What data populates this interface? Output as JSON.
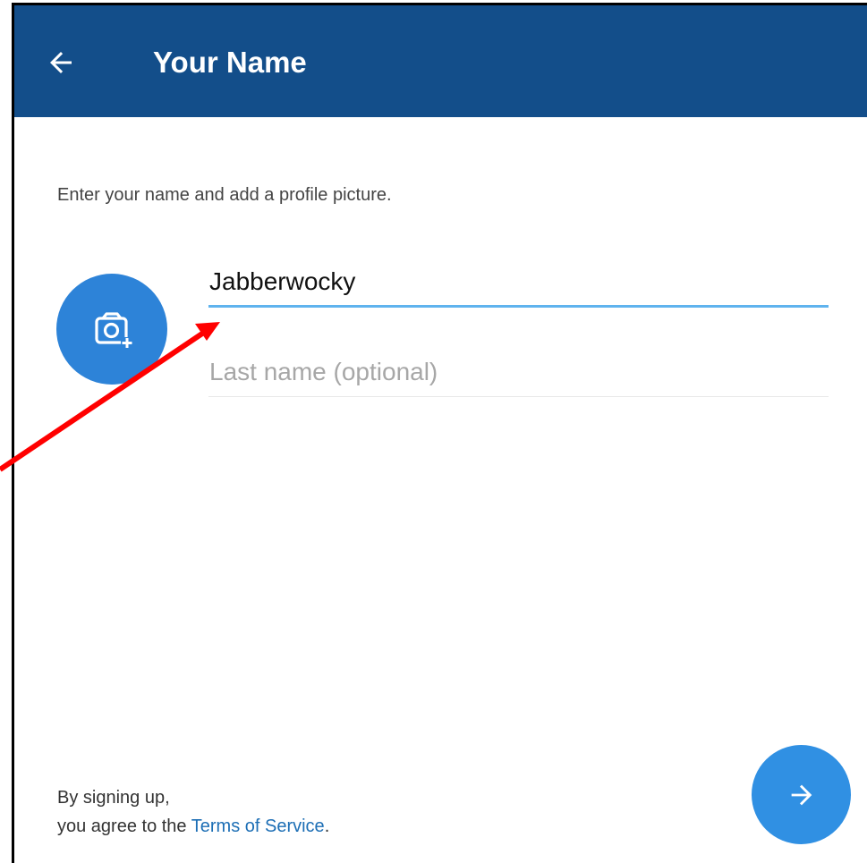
{
  "header": {
    "back_icon": "arrow-left-icon",
    "title": "Your Name",
    "background_color": "#134e8a"
  },
  "form": {
    "instructions": "Enter your name and add a profile picture.",
    "avatar_icon": "camera-add-icon",
    "first_name_value": "Jabberwocky",
    "last_name_placeholder": "Last name (optional)",
    "accent_color": "#2d83d8"
  },
  "footer": {
    "terms_line1": "By signing up,",
    "terms_prefix": "you agree to the ",
    "terms_link": "Terms of Service",
    "terms_suffix": ".",
    "next_icon": "arrow-right-icon"
  },
  "annotation": {
    "arrow_color": "#ff0000"
  }
}
